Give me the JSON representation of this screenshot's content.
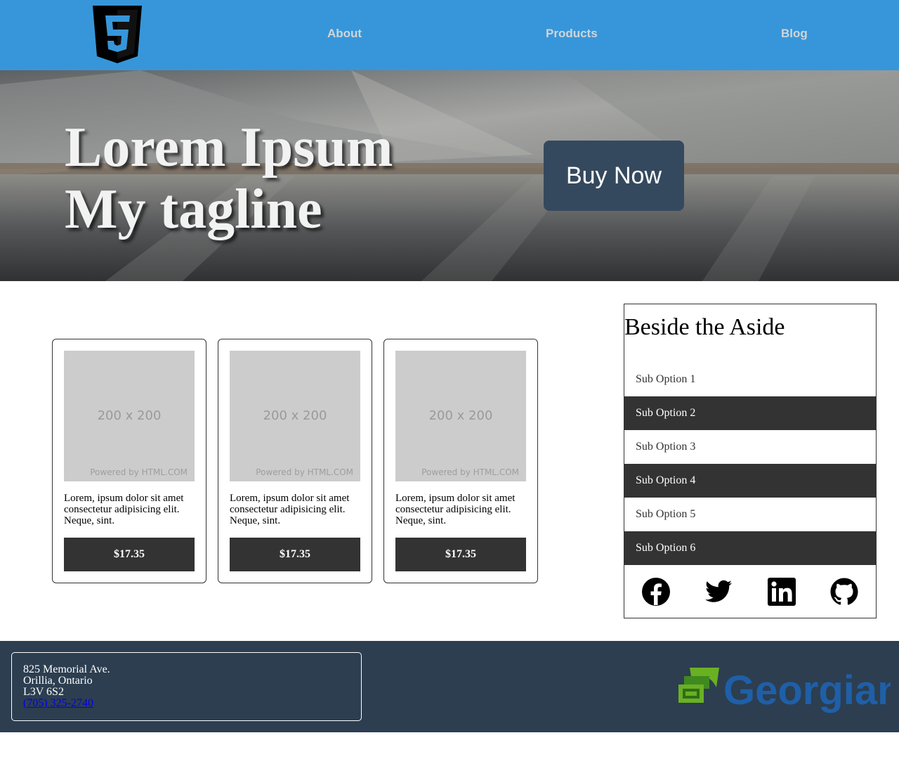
{
  "header": {
    "logo": "html5-logo",
    "nav": [
      "About",
      "Products",
      "Blog"
    ]
  },
  "hero": {
    "title_line1": "Lorem Ipsum",
    "title_line2": "My tagline",
    "cta_label": "Buy Now"
  },
  "products": [
    {
      "image_size": "200 x 200",
      "image_credit": "Powered by HTML.COM",
      "description": "Lorem, ipsum dolor sit amet consectetur adipisicing elit. Neque, sint.",
      "price": "$17.35"
    },
    {
      "image_size": "200 x 200",
      "image_credit": "Powered by HTML.COM",
      "description": "Lorem, ipsum dolor sit amet consectetur adipisicing elit. Neque, sint.",
      "price": "$17.35"
    },
    {
      "image_size": "200 x 200",
      "image_credit": "Powered by HTML.COM",
      "description": "Lorem, ipsum dolor sit amet consectetur adipisicing elit. Neque, sint.",
      "price": "$17.35"
    }
  ],
  "aside": {
    "title": "Beside the Aside",
    "options": [
      "Sub Option 1",
      "Sub Option 2",
      "Sub Option 3",
      "Sub Option 4",
      "Sub Option 5",
      "Sub Option 6"
    ],
    "social": [
      "facebook-icon",
      "twitter-icon",
      "linkedin-icon",
      "github-icon"
    ]
  },
  "footer": {
    "address_line1": "825 Memorial Ave.",
    "address_line2": "Orillia, Ontario",
    "postal_code": "L3V 6S2",
    "phone": "(705) 325-2740",
    "brand": "Georgian",
    "brand_color": "#1f5fa8",
    "brand_accent": "#6ab023"
  },
  "colors": {
    "header_bg": "#3796d9",
    "nav_text": "#d0d5da",
    "cta_bg": "#34495e",
    "dark_bg": "#333333",
    "footer_bg": "#2c3e50"
  }
}
